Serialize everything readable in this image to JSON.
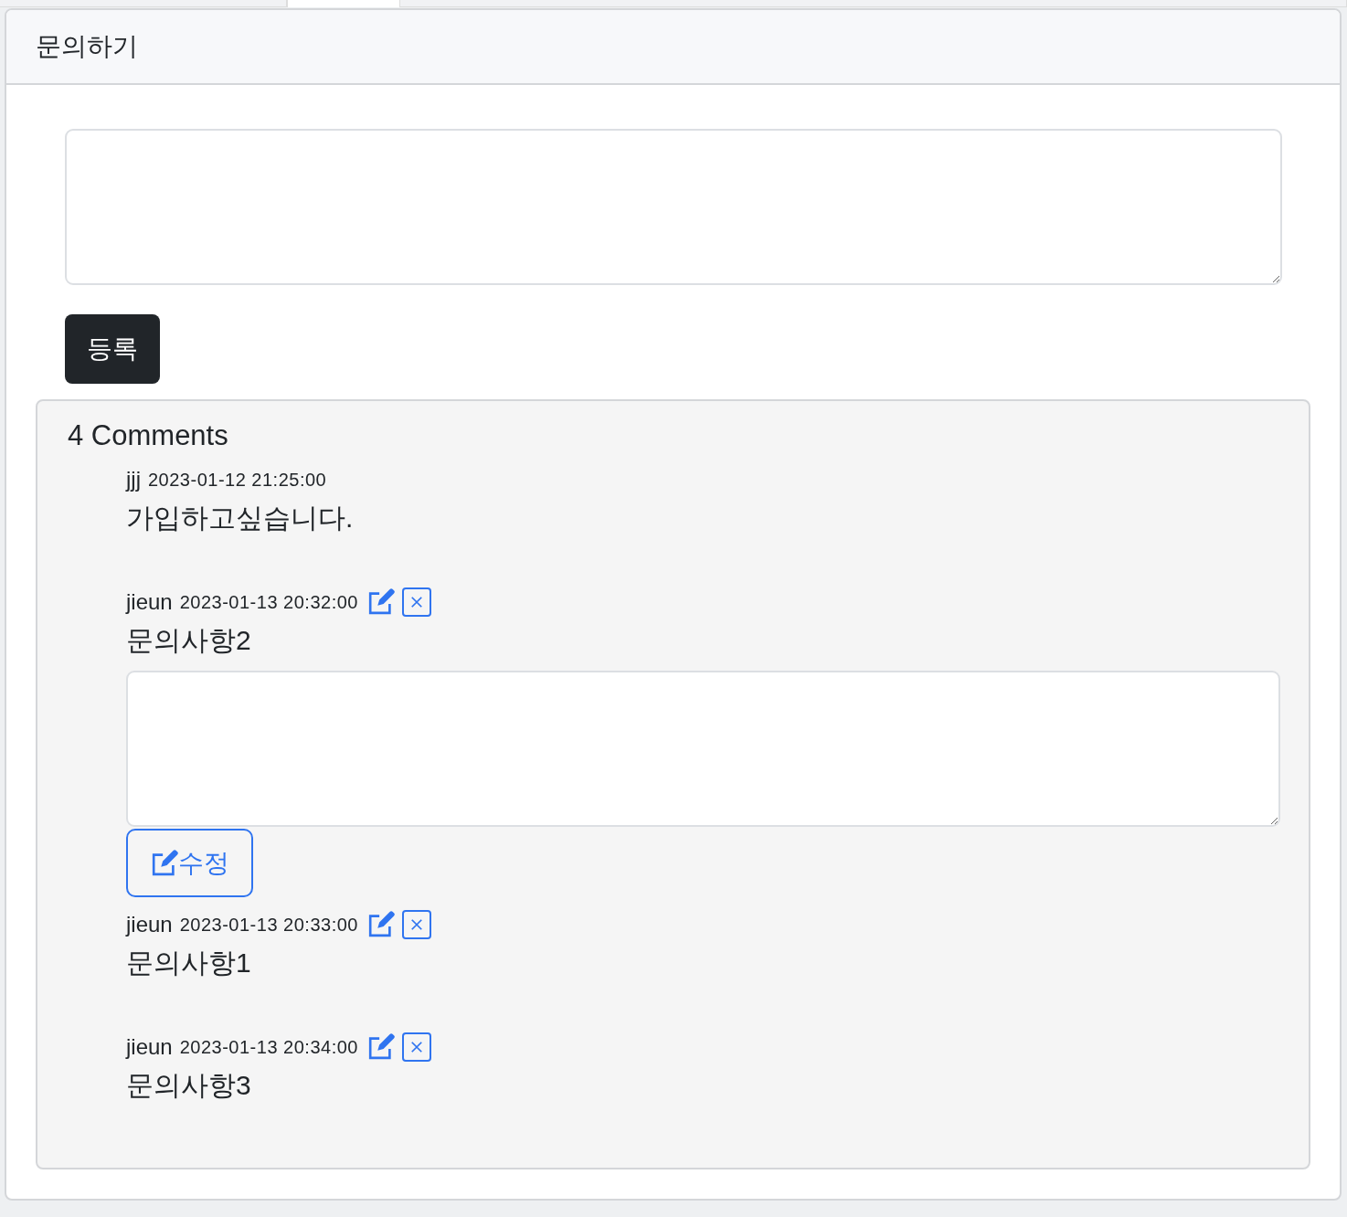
{
  "tabs": [
    {
      "selected": false
    },
    {
      "selected": true
    },
    {
      "selected": false
    }
  ],
  "card": {
    "title": "문의하기",
    "submit_button": "등록"
  },
  "comments_header": "4 Comments",
  "comments": [
    {
      "author": "jjj",
      "date": "2023-01-12 21:25:00",
      "body": "가입하고싶습니다.",
      "editable": false
    },
    {
      "author": "jieun",
      "date": "2023-01-13 20:32:00",
      "body": "문의사항2",
      "editable": true,
      "edit_form": {
        "button": "수정"
      }
    },
    {
      "author": "jieun",
      "date": "2023-01-13 20:33:00",
      "body": "문의사항1",
      "editable": true
    },
    {
      "author": "jieun",
      "date": "2023-01-13 20:34:00",
      "body": "문의사항3",
      "editable": true
    }
  ]
}
